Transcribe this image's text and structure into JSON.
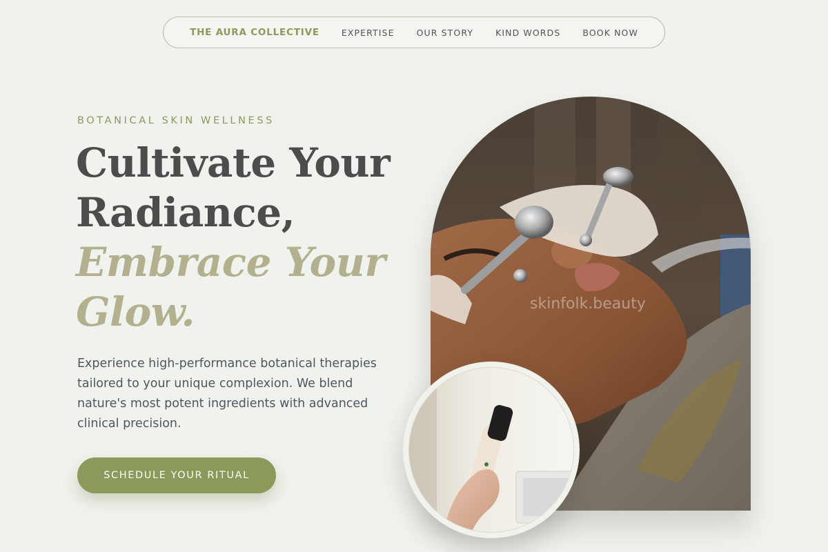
{
  "nav": {
    "brand": "THE AURA COLLECTIVE",
    "links": [
      "EXPERTISE",
      "OUR STORY",
      "KIND WORDS",
      "BOOK NOW"
    ]
  },
  "hero": {
    "eyebrow": "BOTANICAL SKIN WELLNESS",
    "headline_line1": "Cultivate Your",
    "headline_line2": "Radiance,",
    "headline_accent1": "Embrace Your",
    "headline_accent2": "Glow.",
    "intro": "Experience high-performance botanical therapies tailored to your unique complexion. We blend nature's most potent ingredients with advanced clinical precision.",
    "cta_label": "SCHEDULE YOUR RITUAL"
  },
  "media": {
    "arch_watermark": "skinfolk.beauty"
  },
  "colors": {
    "background": "#f0f2ed",
    "accent": "#8a9a5b",
    "headline": "#4b4d4d",
    "headline_accent": "#b3b08f"
  }
}
